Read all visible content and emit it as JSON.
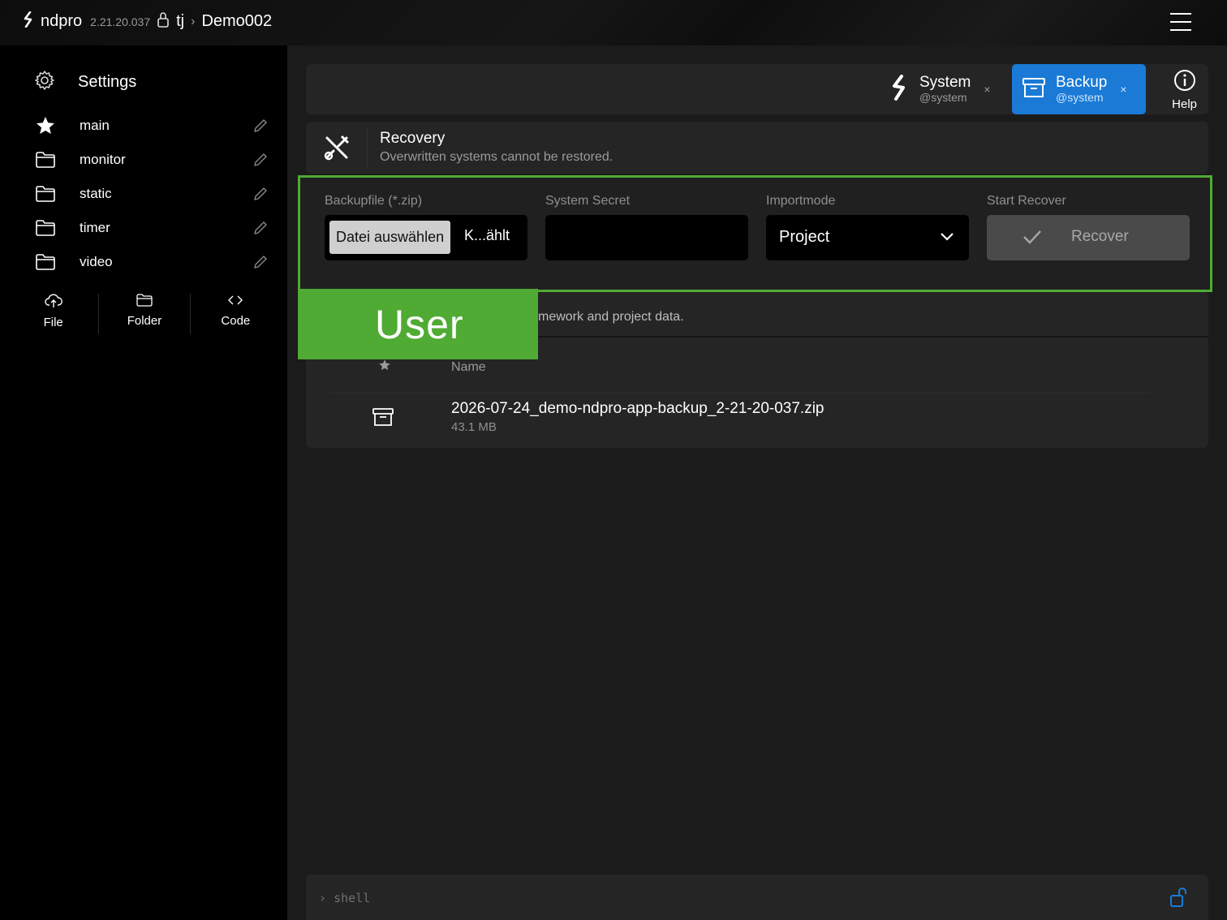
{
  "header": {
    "app_name": "ndpro",
    "version": "2.21.20.037",
    "user": "tj",
    "separator": "›",
    "project": "Demo002"
  },
  "sidebar": {
    "settings_label": "Settings",
    "items": [
      {
        "label": "main",
        "icon": "star-icon"
      },
      {
        "label": "monitor",
        "icon": "folder-icon"
      },
      {
        "label": "static",
        "icon": "folder-icon"
      },
      {
        "label": "timer",
        "icon": "folder-icon"
      },
      {
        "label": "video",
        "icon": "folder-icon"
      }
    ],
    "actions": [
      {
        "label": "File",
        "icon": "cloud-upload-icon"
      },
      {
        "label": "Folder",
        "icon": "folder-icon"
      },
      {
        "label": "Code",
        "icon": "code-icon"
      }
    ]
  },
  "tabs": [
    {
      "title": "System",
      "subtitle": "@system",
      "close": "×",
      "active": false
    },
    {
      "title": "Backup",
      "subtitle": "@system",
      "close": "×",
      "active": true
    }
  ],
  "help_label": "Help",
  "recovery": {
    "title": "Recovery",
    "subtitle": "Overwritten systems cannot be restored."
  },
  "form": {
    "backupfile_label": "Backupfile (*.zip)",
    "file_button": "Datei auswählen",
    "file_status": "K...ählt",
    "secret_label": "System Secret",
    "secret_value": "",
    "importmode_label": "Importmode",
    "importmode_value": "Project",
    "recover_label": "Start Recover",
    "recover_button": "Recover"
  },
  "overlay_tag": "User",
  "backup_list": {
    "description_visible": "mework and project data.",
    "column_name": "Name",
    "files": [
      {
        "name": "2026-07-24_demo-ndpro-app-backup_2-21-20-037.zip",
        "size": "43.1 MB"
      }
    ]
  },
  "shell": {
    "prompt": "›",
    "placeholder": "shell"
  },
  "colors": {
    "accent": "#1a7ad6",
    "highlight": "#4fab33"
  }
}
